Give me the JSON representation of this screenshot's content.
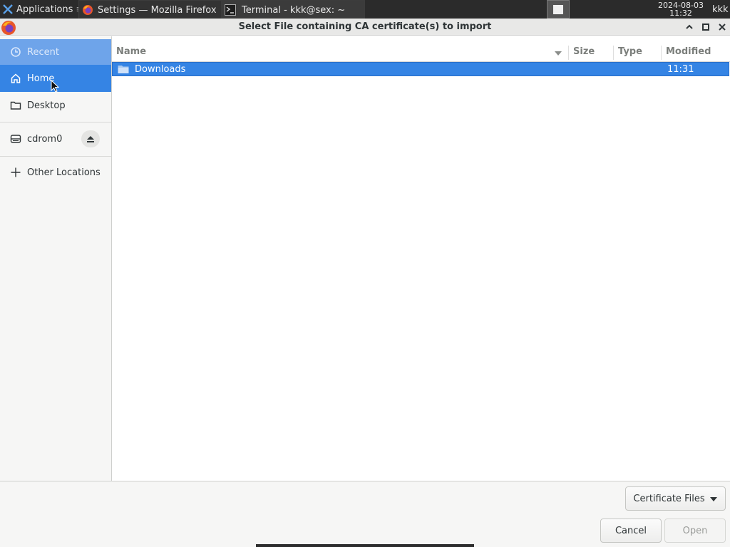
{
  "taskbar": {
    "applications_label": "Applications",
    "tasks": [
      {
        "label": "Settings — Mozilla Firefox"
      },
      {
        "label": "Terminal - kkk@sex: ~"
      }
    ],
    "date": "2024-08-03",
    "time": "11:32",
    "user": "kkk"
  },
  "dialog": {
    "title": "Select File containing CA certificate(s) to import"
  },
  "sidebar": {
    "items": [
      {
        "label": "Recent",
        "icon": "recent-icon"
      },
      {
        "label": "Home",
        "icon": "home-icon"
      },
      {
        "label": "Desktop",
        "icon": "folder-icon"
      },
      {
        "label": "cdrom0",
        "icon": "drive-icon"
      },
      {
        "label": "Other Locations",
        "icon": "plus-icon"
      }
    ]
  },
  "filelist": {
    "columns": {
      "name": "Name",
      "size": "Size",
      "type": "Type",
      "modified": "Modified"
    },
    "rows": [
      {
        "name": "Downloads",
        "size": "",
        "type": "",
        "modified": "11:31"
      }
    ]
  },
  "footer": {
    "filter": "Certificate Files",
    "cancel": "Cancel",
    "open": "Open"
  },
  "colors": {
    "accent": "#3584e4",
    "panel": "#2b2b2b"
  }
}
